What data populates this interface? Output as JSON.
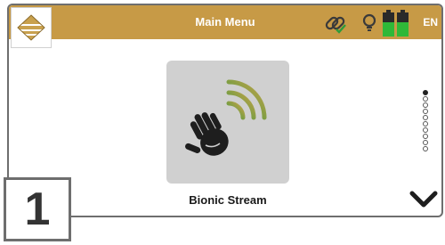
{
  "header": {
    "title": "Main Menu",
    "language": "EN",
    "background_color": "#c79a46",
    "icons": [
      "logo-icon",
      "link-status-icon",
      "bulb-icon",
      "battery-icon",
      "battery-icon"
    ]
  },
  "menu_item": {
    "label": "Bionic Stream",
    "icon": "hand-stream-icon"
  },
  "pagination": {
    "total": 10,
    "active_index": 0
  },
  "page_number": "1"
}
